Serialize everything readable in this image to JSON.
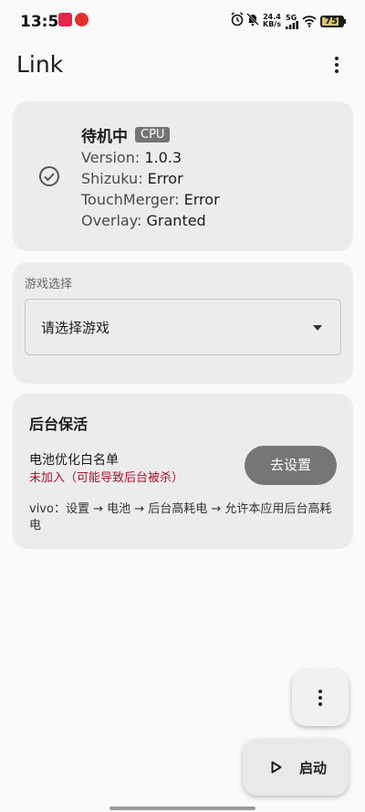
{
  "status_bar": {
    "time": "13:55",
    "net_speed_value": "24.4",
    "net_speed_unit": "KB/s",
    "network": "5G",
    "battery": "75",
    "icons": [
      "alarm-icon",
      "mute-icon",
      "signal-icon",
      "wifi-icon",
      "battery-icon"
    ]
  },
  "app_bar": {
    "title": "Link",
    "overflow_icon": "more-vert-icon"
  },
  "status_card": {
    "title": "待机中",
    "badge": "CPU",
    "icon": "check-circle-icon",
    "version_label": "Version: ",
    "version_value": "1.0.3",
    "shizuku_label": "Shizuku: ",
    "shizuku_value": "Error",
    "touchmerger_label": "TouchMerger: ",
    "touchmerger_value": "Error",
    "overlay_label": "Overlay: ",
    "overlay_value": "Granted"
  },
  "game_card": {
    "label": "游戏选择",
    "selected": "请选择游戏"
  },
  "keepalive_card": {
    "title": "后台保活",
    "item_label": "电池优化白名单",
    "item_status": "未加入（可能导致后台被杀）",
    "button_label": "去设置",
    "note": "vivo：设置 → 电池 → 后台高耗电 → 允许本应用后台高耗电"
  },
  "fab": {
    "start_label": "启动"
  },
  "colors": {
    "accent_error": "#a8132d",
    "card_bg": "#ececec",
    "button_bg": "#767676"
  }
}
